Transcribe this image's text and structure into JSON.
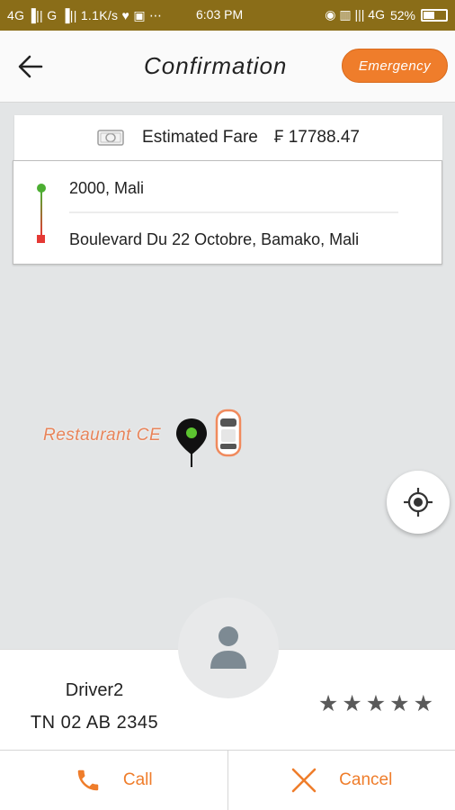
{
  "status_bar": {
    "left": "4G ▐|| G ▐|| 1.1K/s ♥ ▣ ⋯",
    "time": "6:03 PM",
    "right_signal": "◉ ▥ ||| 4G",
    "battery": "52%"
  },
  "header": {
    "title": "Confirmation",
    "emergency_label": "Emergency"
  },
  "fare": {
    "label": "Estimated Fare",
    "amount": "₣ 17788.47"
  },
  "route": {
    "pickup": "2000, Mali",
    "drop": "Boulevard Du 22 Octobre, Bamako, Mali"
  },
  "map": {
    "poi_label": "Restaurant CE"
  },
  "driver": {
    "name": "Driver2",
    "plate": "TN 02 AB 2345",
    "rating": 5
  },
  "actions": {
    "call_label": "Call",
    "cancel_label": "Cancel"
  },
  "colors": {
    "accent": "#ef7d2b",
    "status_bar": "#8a6d18",
    "pickup_dot": "#4cae32",
    "drop_dot": "#e53935"
  }
}
